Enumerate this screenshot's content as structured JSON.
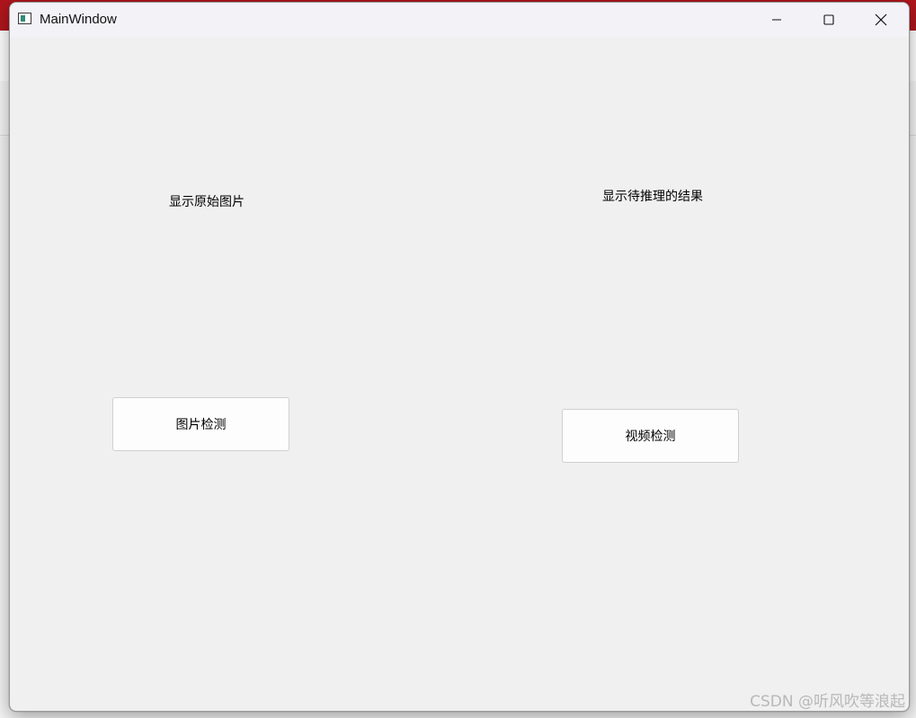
{
  "window": {
    "title": "MainWindow"
  },
  "labels": {
    "original_image": "显示原始图片",
    "inference_result": "显示待推理的结果"
  },
  "buttons": {
    "image_detect": "图片检测",
    "video_detect": "视频检测"
  },
  "watermark": "CSDN @听风吹等浪起",
  "icons": {
    "minimize": "minimize-icon",
    "maximize": "maximize-icon",
    "close": "close-icon",
    "app": "app-window-icon"
  },
  "colors": {
    "background_bar": "#b0161c",
    "window_bg": "#f0f0f0",
    "titlebar_bg": "#f2f2f7",
    "button_bg": "#fdfdfd"
  }
}
